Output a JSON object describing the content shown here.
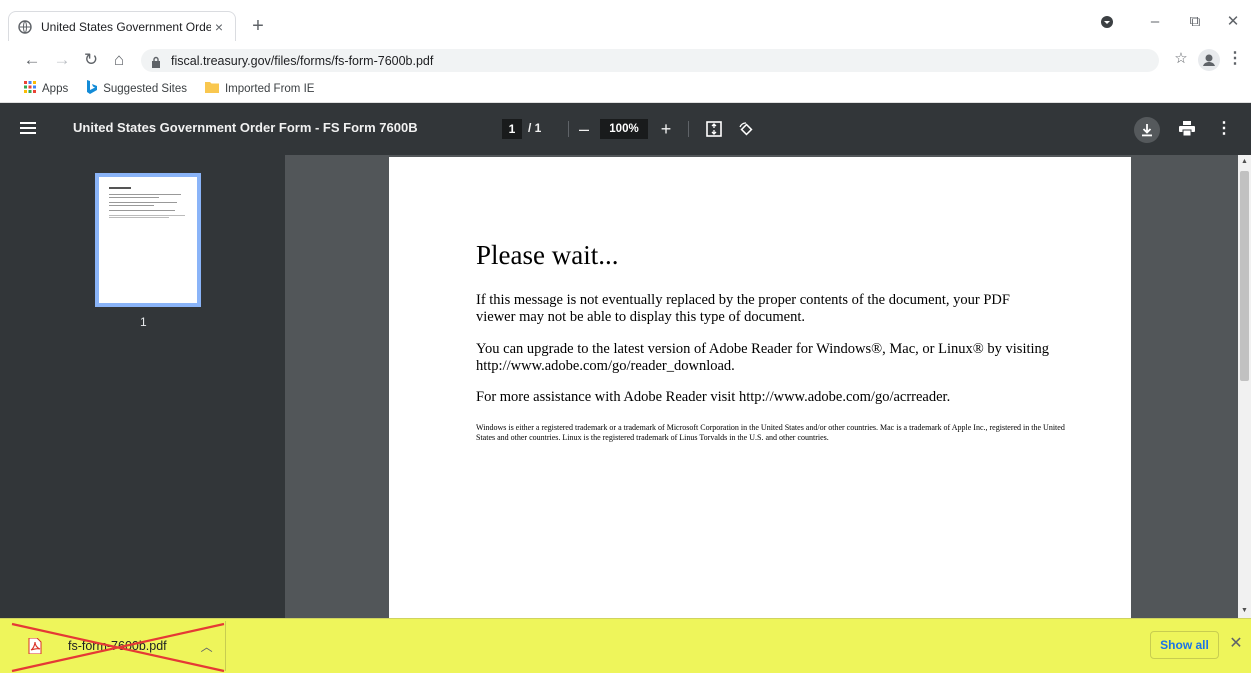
{
  "browser": {
    "tab_title": "United States Government Order",
    "tab_close": "×",
    "new_tab": "+",
    "win_minimize": "–",
    "win_restore": "⧉",
    "win_close": "✕",
    "url": "fiscal.treasury.gov/files/forms/fs-form-7600b.pdf",
    "bookmarks": [
      {
        "label": "Apps"
      },
      {
        "label": "Suggested Sites"
      },
      {
        "label": "Imported From IE"
      }
    ]
  },
  "pdf_viewer": {
    "title": "United States Government Order Form - FS Form 7600B",
    "current_page": "1",
    "page_total": "/ 1",
    "zoom": "100%",
    "zoom_out": "–",
    "zoom_in": "+",
    "thumbnail_number": "1"
  },
  "document": {
    "heading": "Please wait...",
    "para1": "If this message is not eventually replaced by the proper contents of the document, your PDF viewer may not be able to display this type of document.",
    "para2": "You can upgrade to the latest version of Adobe Reader for Windows®, Mac, or Linux® by visiting  http://www.adobe.com/go/reader_download.",
    "para3": "For more assistance with Adobe Reader visit  http://www.adobe.com/go/acrreader.",
    "trademark": "Windows is either a registered trademark or a trademark of Microsoft Corporation in the United States and/or other countries. Mac is a trademark of Apple Inc., registered in the United States and other countries. Linux is the registered trademark of Linus Torvalds in the U.S. and other countries."
  },
  "download_bar": {
    "file_name": "fs-form-7600b.pdf",
    "show_all": "Show all",
    "close": "✕",
    "highlight_color": "#eef55b",
    "cross_color": "#e53935"
  },
  "colors": {
    "pdf_toolbar": "#323639",
    "viewport": "#525659",
    "thumb_border": "#8ab4f8"
  }
}
